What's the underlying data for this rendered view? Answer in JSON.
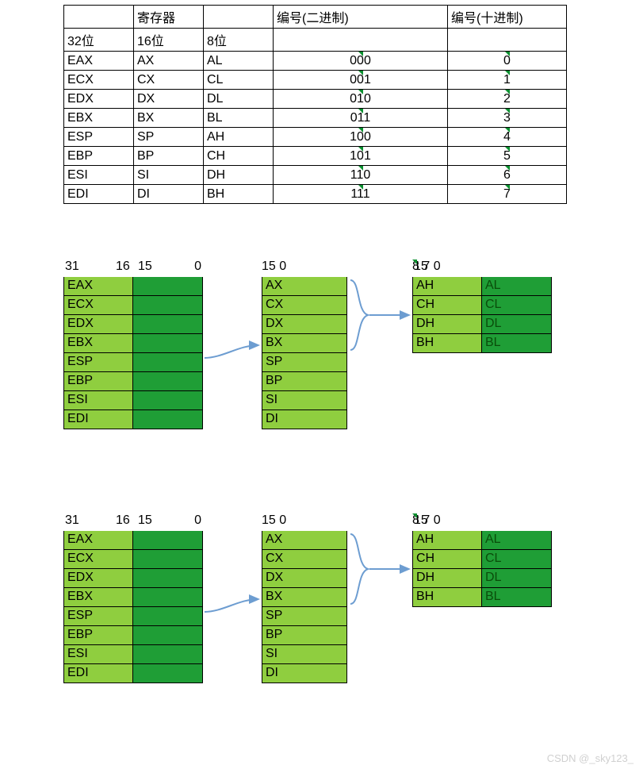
{
  "table": {
    "header1": {
      "reg": "寄存器",
      "bin": "编号(二进制)",
      "dec": "编号(十进制)"
    },
    "header2": {
      "b32": "32位",
      "b16": "16位",
      "b8": "8位"
    },
    "rows": [
      {
        "r32": "EAX",
        "r16": "AX",
        "r8": "AL",
        "bin": "000",
        "dec": "0"
      },
      {
        "r32": "ECX",
        "r16": "CX",
        "r8": "CL",
        "bin": "001",
        "dec": "1"
      },
      {
        "r32": "EDX",
        "r16": "DX",
        "r8": "DL",
        "bin": "010",
        "dec": "2"
      },
      {
        "r32": "EBX",
        "r16": "BX",
        "r8": "BL",
        "bin": "011",
        "dec": "3"
      },
      {
        "r32": "ESP",
        "r16": "SP",
        "r8": "AH",
        "bin": "100",
        "dec": "4"
      },
      {
        "r32": "EBP",
        "r16": "BP",
        "r8": "CH",
        "bin": "101",
        "dec": "5"
      },
      {
        "r32": "ESI",
        "r16": "SI",
        "r8": "DH",
        "bin": "110",
        "dec": "6"
      },
      {
        "r32": "EDI",
        "r16": "DI",
        "r8": "BH",
        "bin": "111",
        "dec": "7"
      }
    ]
  },
  "diagram": {
    "bits32": {
      "hdr": {
        "a": "31",
        "b": "16",
        "c": "15",
        "d": "0"
      },
      "rows": [
        "EAX",
        "ECX",
        "EDX",
        "EBX",
        "ESP",
        "EBP",
        "ESI",
        "EDI"
      ]
    },
    "bits16": {
      "hdr": {
        "a": "15",
        "b": "0"
      },
      "rows": [
        "AX",
        "CX",
        "DX",
        "BX",
        "SP",
        "BP",
        "SI",
        "DI"
      ]
    },
    "bits8": {
      "hdr": {
        "a": "15",
        "b": "8",
        "c": "7",
        "d": "0"
      },
      "rows": [
        {
          "h": "AH",
          "l": "AL"
        },
        {
          "h": "CH",
          "l": "CL"
        },
        {
          "h": "DH",
          "l": "DL"
        },
        {
          "h": "BH",
          "l": "BL"
        }
      ]
    }
  },
  "colors": {
    "light": "#8fce3f",
    "dark": "#1f9e36",
    "arrow": "#6d9dd1"
  },
  "watermark": "CSDN @_sky123_"
}
